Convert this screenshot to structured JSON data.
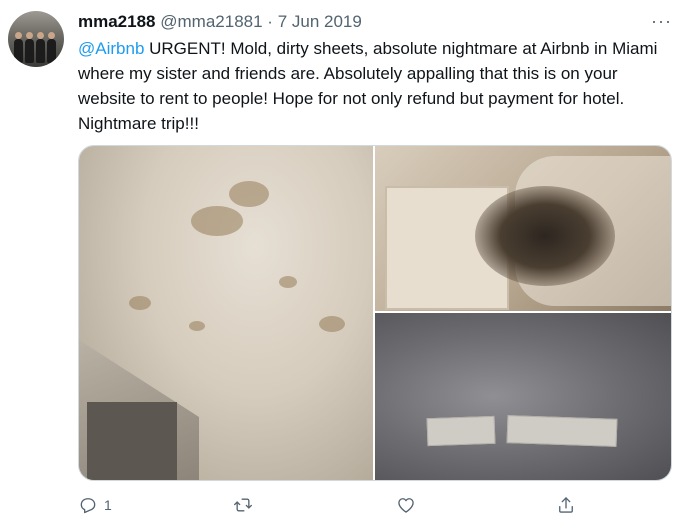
{
  "tweet": {
    "display_name": "mma2188",
    "handle": "@mma21881",
    "separator": "·",
    "date": "7 Jun 2019",
    "mention": "@Airbnb",
    "body": " URGENT! Mold, dirty sheets, absolute nightmare at Airbnb in Miami where my sister and friends are. Absolutely appalling that this is on your website to rent to people! Hope for not only refund but payment for hotel. Nightmare trip!!!",
    "more_icon": "more-horizontal-icon",
    "more_label": "···"
  },
  "actions": {
    "reply_count": "1",
    "reply_icon": "reply-icon",
    "retweet_icon": "retweet-icon",
    "like_icon": "heart-icon",
    "share_icon": "share-icon"
  },
  "colors": {
    "accent": "#1d9bf0",
    "secondary_text": "#536471",
    "border": "#cfd9de"
  }
}
